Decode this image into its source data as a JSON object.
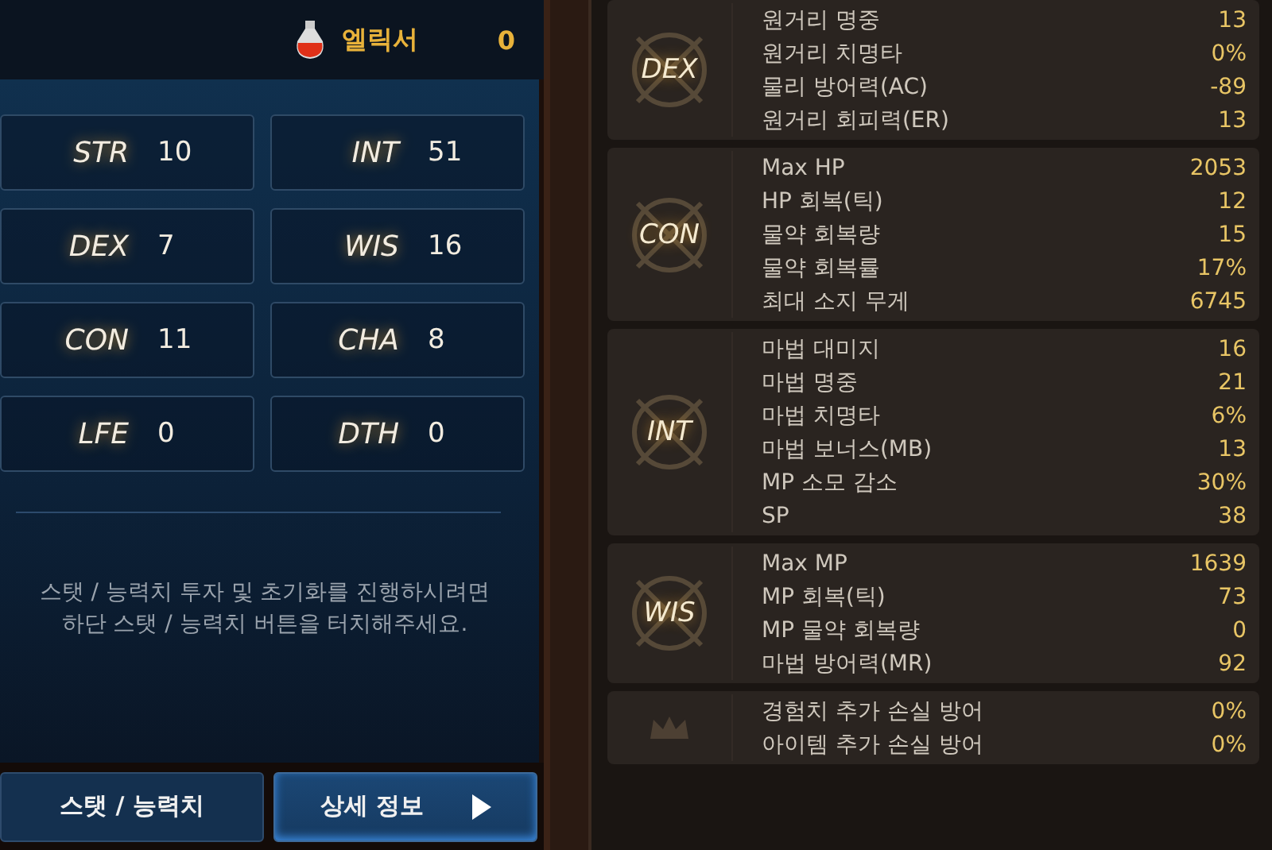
{
  "elixir": {
    "label": "엘릭서",
    "count": "0"
  },
  "stats": [
    {
      "name": "STR",
      "value": "10"
    },
    {
      "name": "INT",
      "value": "51"
    },
    {
      "name": "DEX",
      "value": "7"
    },
    {
      "name": "WIS",
      "value": "16"
    },
    {
      "name": "CON",
      "value": "11"
    },
    {
      "name": "CHA",
      "value": "8"
    },
    {
      "name": "LFE",
      "value": "0"
    },
    {
      "name": "DTH",
      "value": "0"
    }
  ],
  "notice": "스탯 / 능력치 투자 및 초기화를 진행하시려면 하단 스탯 / 능력치 버튼을 터치해주세요.",
  "tabs": [
    {
      "label": "스탯 / 능력치",
      "selected": false,
      "arrow": false
    },
    {
      "label": "상세 정보",
      "selected": true,
      "arrow": true
    }
  ],
  "groups": [
    {
      "emblem": "DEX",
      "rows": [
        {
          "label": "원거리 명중",
          "value": "13"
        },
        {
          "label": "원거리 치명타",
          "value": "0%"
        },
        {
          "label": "물리 방어력(AC)",
          "value": "-89"
        },
        {
          "label": "원거리 회피력(ER)",
          "value": "13"
        }
      ]
    },
    {
      "emblem": "CON",
      "rows": [
        {
          "label": "Max HP",
          "value": "2053"
        },
        {
          "label": "HP 회복(틱)",
          "value": "12"
        },
        {
          "label": "물약 회복량",
          "value": "15"
        },
        {
          "label": "물약 회복률",
          "value": "17%"
        },
        {
          "label": "최대 소지 무게",
          "value": "6745"
        }
      ]
    },
    {
      "emblem": "INT",
      "rows": [
        {
          "label": "마법 대미지",
          "value": "16"
        },
        {
          "label": "마법 명중",
          "value": "21"
        },
        {
          "label": "마법 치명타",
          "value": "6%"
        },
        {
          "label": "마법 보너스(MB)",
          "value": "13"
        },
        {
          "label": "MP 소모 감소",
          "value": "30%"
        },
        {
          "label": "SP",
          "value": "38"
        }
      ]
    },
    {
      "emblem": "WIS",
      "rows": [
        {
          "label": "Max MP",
          "value": "1639"
        },
        {
          "label": "MP 회복(틱)",
          "value": "73"
        },
        {
          "label": "MP 물약 회복량",
          "value": "0"
        },
        {
          "label": "마법 방어력(MR)",
          "value": "92"
        }
      ]
    },
    {
      "rows": [
        {
          "label": "경험치 추가 손실 방어",
          "value": "0%"
        },
        {
          "label": "아이템 추가 손실 방어",
          "value": "0%"
        }
      ]
    }
  ]
}
